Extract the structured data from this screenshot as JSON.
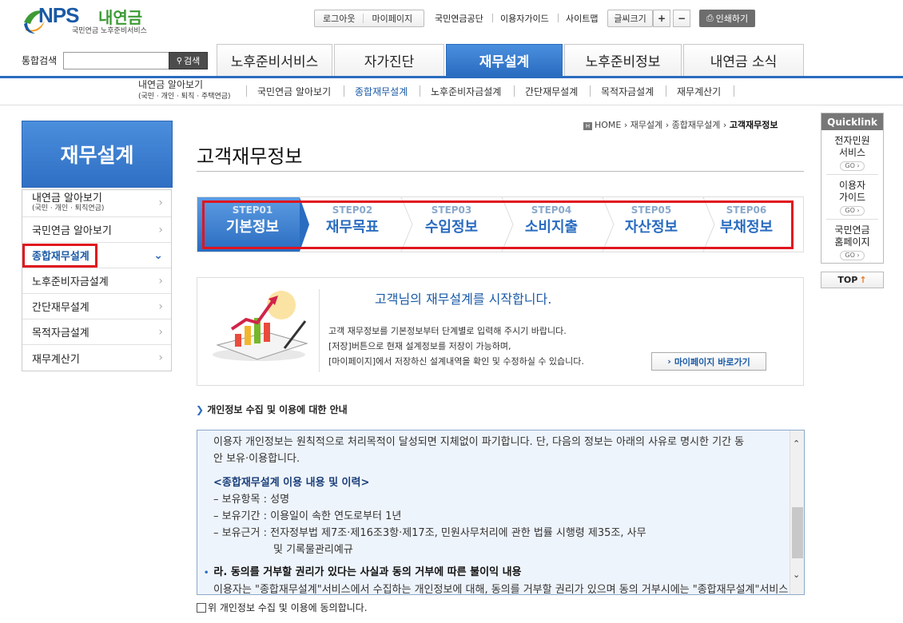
{
  "header": {
    "logo_main": "NPS",
    "logo_kr": "내연금",
    "logo_sub": "국민연금 노후준비서비스",
    "util": {
      "logout": "로그아웃",
      "mypage": "마이페이지",
      "nps": "국민연금공단",
      "guide": "이용자가이드",
      "sitemap": "사이트맵",
      "fontsize": "글씨크기",
      "plus": "+",
      "minus": "−",
      "print": "인쇄하기"
    },
    "search": {
      "label": "통합검색",
      "button": "검색",
      "placeholder": ""
    }
  },
  "gnb": [
    "노후준비서비스",
    "자가진단",
    "재무설계",
    "노후준비정보",
    "내연금 소식"
  ],
  "subnav": {
    "first_line1": "내연금 알아보기",
    "first_line2": "(국민 · 개인 · 퇴직 · 주택연금)",
    "items": [
      "국민연금 알아보기",
      "종합재무설계",
      "노후준비자금설계",
      "간단재무설계",
      "목적자금설계",
      "재무계산기"
    ]
  },
  "lnb": {
    "title": "재무설계",
    "first_line1": "내연금 알아보기",
    "first_line2": "(국민 · 개인 · 퇴직연금)",
    "items": [
      "국민연금 알아보기",
      "종합재무설계",
      "노후준비자금설계",
      "간단재무설계",
      "목적자금설계",
      "재무계산기"
    ]
  },
  "breadcrumb": {
    "home": "HOME",
    "b1": "재무설계",
    "b2": "종합재무설계",
    "b3": "고객재무정보"
  },
  "page_title": "고객재무정보",
  "steps": [
    {
      "label": "STEP01",
      "name": "기본정보"
    },
    {
      "label": "STEP02",
      "name": "재무목표"
    },
    {
      "label": "STEP03",
      "name": "수입정보"
    },
    {
      "label": "STEP04",
      "name": "소비지출"
    },
    {
      "label": "STEP05",
      "name": "자산정보"
    },
    {
      "label": "STEP06",
      "name": "부채정보"
    }
  ],
  "intro": {
    "title": "고객님의 재무설계를 시작합니다.",
    "line1": "고객 재무정보를 기본정보부터 단계별로 입력해 주시기 바랍니다.",
    "line2": "[저장]버튼으로 현재 설계정보를 저장이 가능하며,",
    "line3": "[마이페이지]에서 저장하신 설계내역을 확인 및 수정하실 수 있습니다.",
    "button": "마이페이지 바로가기"
  },
  "privacy": {
    "section_title": "개인정보 수집 및 이용에 대한 안내",
    "p1": "이용자 개인정보는 원칙적으로 처리목적이 달성되면 지체없이 파기합니다. 단, 다음의 정보는 아래의 사유로 명시한 기간 동",
    "p1b": "안 보유·이용합니다.",
    "head": "<종합재무설계 이용 내용 및 이력>",
    "l1": "– 보유항목 : 성명",
    "l2": "– 보유기간 : 이용일이 속한 연도로부터 1년",
    "l3": "– 보유근거 : 전자정부법 제7조·제16조3항·제17조, 민원사무처리에 관한 법률 시행령 제35조, 사무",
    "l3b": "및 기록물관리예규",
    "head2": "라. 동의를 거부할 권리가 있다는 사실과 동의 거부에 따른 불이익 내용",
    "p2": "이용자는 \"종합재무설계\"서비스에서 수집하는 개인정보에 대해, 동의를 거부할 권리가 있으며 동의 거부시에는 \"종합재무설계\"서비스",
    "agree": "위 개인정보 수집 및 이용에 동의합니다."
  },
  "quicklink": {
    "title": "Quicklink",
    "items": [
      {
        "l1": "전자민원",
        "l2": "서비스"
      },
      {
        "l1": "이용자",
        "l2": "가이드"
      },
      {
        "l1": "국민연금",
        "l2": "홈페이지"
      }
    ],
    "go": "GO",
    "top": "TOP"
  }
}
